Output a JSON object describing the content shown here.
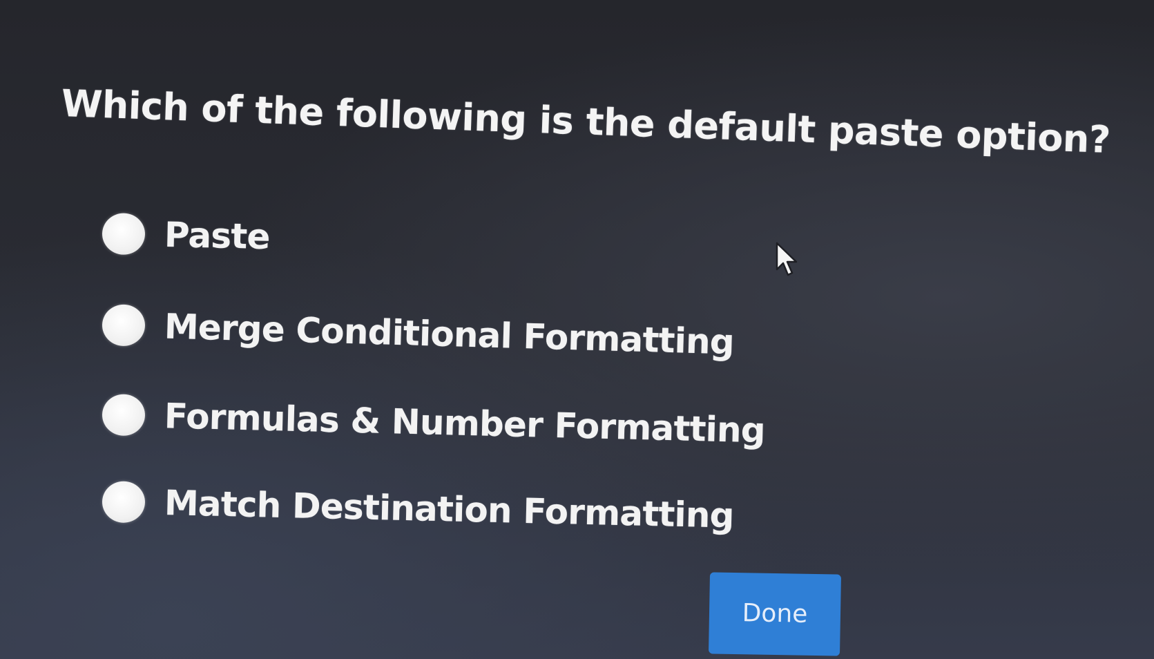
{
  "quiz": {
    "question": "Which of the following is the default paste option?",
    "options": [
      {
        "label": "Paste"
      },
      {
        "label": "Merge Conditional Formatting"
      },
      {
        "label": "Formulas & Number Formatting"
      },
      {
        "label": "Match Destination Formatting"
      }
    ],
    "done_label": "Done"
  },
  "icons": {
    "radio": "radio-button-unselected-icon",
    "cursor": "mouse-pointer-icon"
  },
  "colors": {
    "background": "#2b2d35",
    "text": "#f2f2f2",
    "button": "#2f7fd6",
    "radio": "#f1f1f1"
  }
}
